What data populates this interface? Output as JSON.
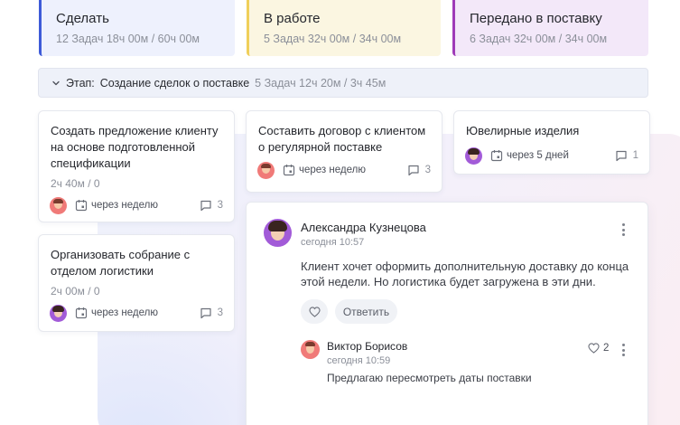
{
  "columns": [
    {
      "title": "Сделать",
      "meta": "12 Задач  18ч 00м / 60ч 00м",
      "accent": "#3e5bd8"
    },
    {
      "title": "В работе",
      "meta": "5 Задач  32ч 00м / 34ч 00м",
      "accent": "#f0cf5a"
    },
    {
      "title": "Передано в поставку",
      "meta": "6 Задач  32ч 00м / 34ч 00м",
      "accent": "#9f3bb8"
    }
  ],
  "stage": {
    "label": "Этап:",
    "name": "Создание сделок о поставке",
    "meta": "5 Задач 12ч 20м / 3ч 45м"
  },
  "cards": [
    {
      "title": "Создать предложение клиенту на основе подготовленной спецификации",
      "time": "2ч 40м / 0",
      "due": "через неделю",
      "comments": "3",
      "assignee_icon": "man-avatar"
    },
    {
      "title": "Организовать собрание с отделом логистики",
      "time": "2ч 00м / 0",
      "due": "через неделю",
      "comments": "3",
      "assignee_icon": "woman-avatar"
    },
    {
      "title": "Составить договор с клиентом о регулярной поставке",
      "due": "через неделю",
      "comments": "3",
      "assignee_icon": "man-avatar"
    },
    {
      "title": "Ювелирные изделия",
      "due": "через 5 дней",
      "comments": "1",
      "assignee_icon": "woman-avatar"
    }
  ],
  "comment_thread": {
    "main": {
      "author": "Александра Кузнецова",
      "time": "сегодня 10:57",
      "text": "Клиент хочет оформить дополнительную доставку до конца этой недели. Но логистика будет загружена в эти дни.",
      "reply_label": "Ответить"
    },
    "reply": {
      "author": "Виктор Борисов",
      "time": "сегодня 10:59",
      "text": "Предлагаю пересмотреть даты поставки",
      "likes": "2"
    }
  }
}
